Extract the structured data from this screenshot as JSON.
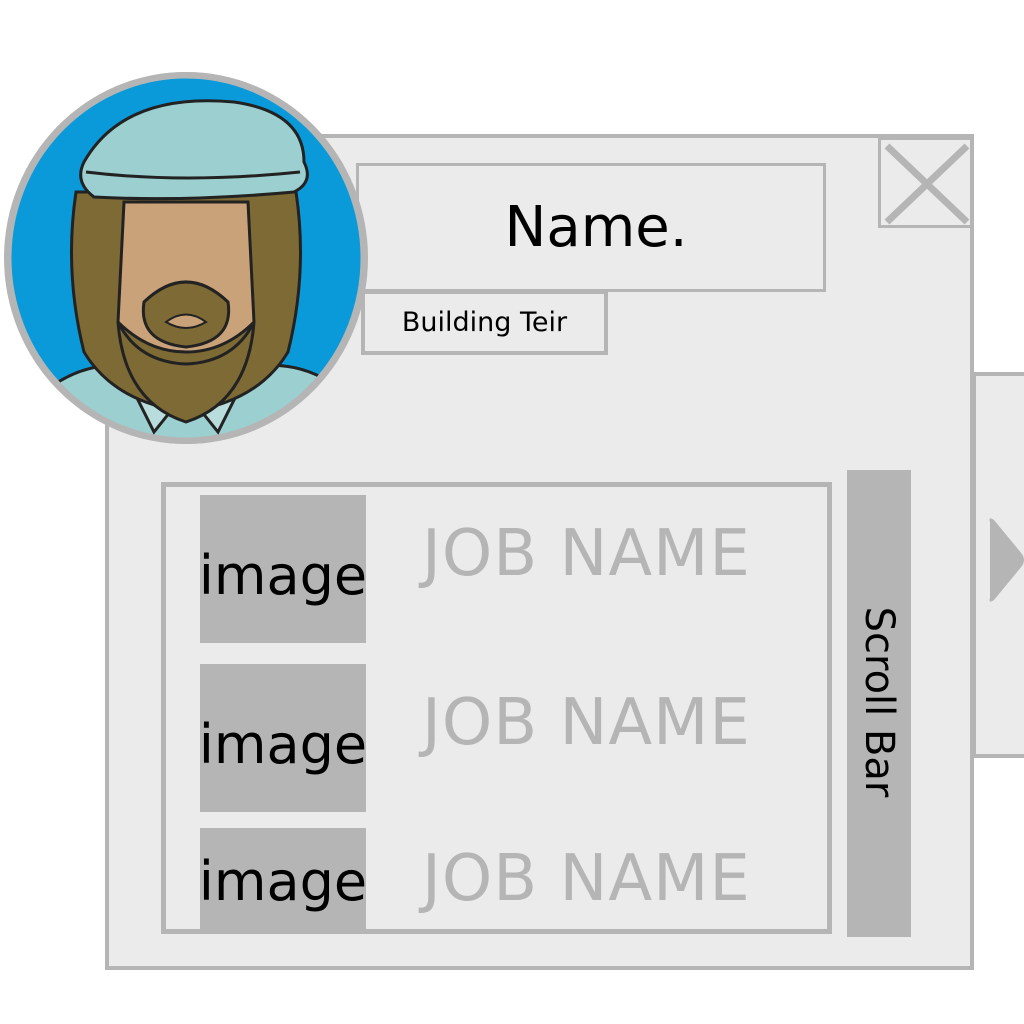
{
  "header": {
    "name_label": "Name.",
    "tier_label": "Building Teir"
  },
  "avatar": {
    "icon": "bearded-man-portrait",
    "ring_color": "#b5b5b5",
    "background": "#0b9ad9"
  },
  "close_button": {
    "icon": "close-icon"
  },
  "job_list": {
    "items": [
      {
        "image_label": "image",
        "job_name": "JOB NAME"
      },
      {
        "image_label": "image",
        "job_name": "JOB NAME"
      },
      {
        "image_label": "image",
        "job_name": "JOB NAME"
      }
    ]
  },
  "scroll_bar": {
    "label": "Scroll Bar"
  },
  "side_panel": {
    "icon": "chevron-right-icon"
  },
  "colors": {
    "panel_bg": "#ebebeb",
    "border": "#b5b5b5",
    "text": "#000000",
    "muted_text": "#b5b5b5"
  }
}
